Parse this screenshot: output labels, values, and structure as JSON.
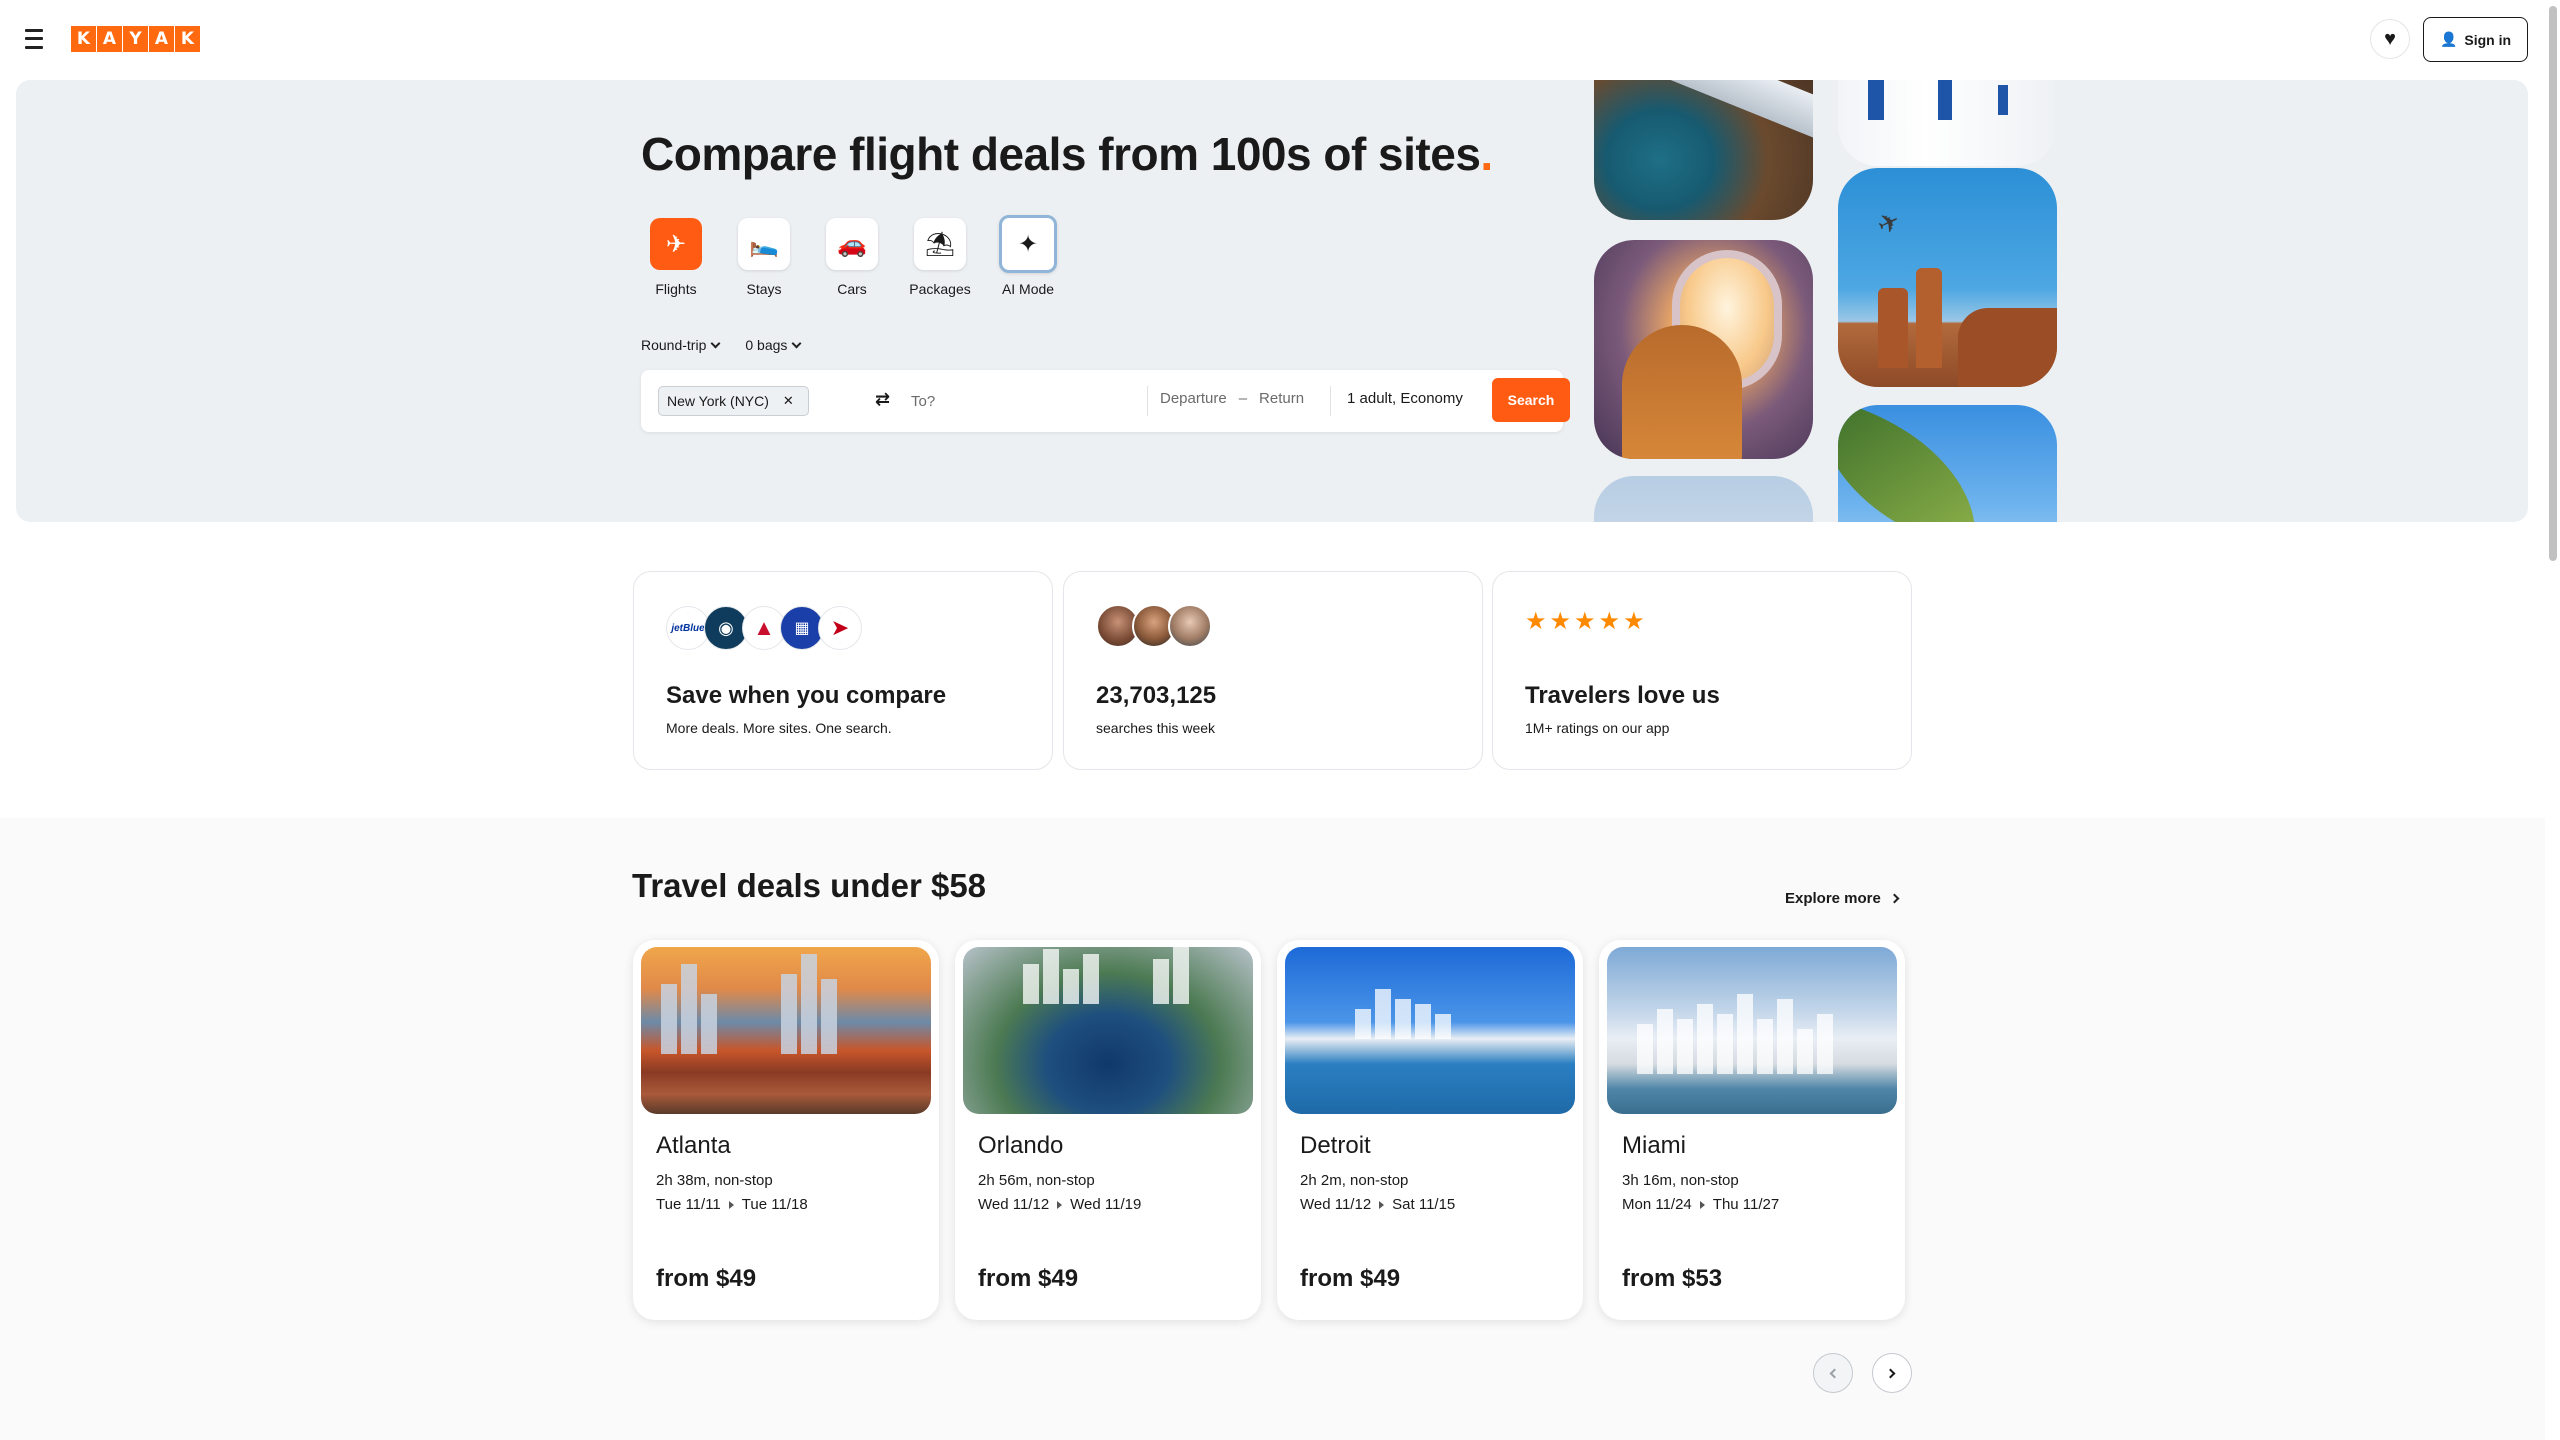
{
  "header": {
    "logo_letters": [
      "K",
      "A",
      "Y",
      "A",
      "K"
    ],
    "signin_label": "Sign in"
  },
  "hero": {
    "title": "Compare flight deals from 100s of sites",
    "title_dot": ".",
    "verticals": [
      {
        "label": "Flights",
        "icon": "plane-icon"
      },
      {
        "label": "Stays",
        "icon": "bed-icon"
      },
      {
        "label": "Cars",
        "icon": "car-icon"
      },
      {
        "label": "Packages",
        "icon": "umbrella-icon"
      },
      {
        "label": "AI Mode",
        "icon": "sparkle-icon"
      }
    ],
    "trip_type": "Round-trip",
    "bags": "0 bags",
    "origin": "New York (NYC)",
    "destination_placeholder": "To?",
    "departure_placeholder": "Departure",
    "date_separator": "–",
    "return_placeholder": "Return",
    "travelers": "1 adult, Economy",
    "search_label": "Search"
  },
  "stats": [
    {
      "title": "Save when you compare",
      "subtitle": "More deals. More sites. One search."
    },
    {
      "title": "23,703,125",
      "subtitle": "searches this week"
    },
    {
      "title": "Travelers love us",
      "subtitle": "1M+ ratings on our app"
    }
  ],
  "airlines": [
    "jetBlue"
  ],
  "deals": {
    "title": "Travel deals under $58",
    "explore_label": "Explore more",
    "cards": [
      {
        "city": "Atlanta",
        "duration": "2h 38m, non-stop",
        "depart": "Tue 11/11",
        "return": "Tue 11/18",
        "price": "from $49"
      },
      {
        "city": "Orlando",
        "duration": "2h 56m, non-stop",
        "depart": "Wed 11/12",
        "return": "Wed 11/19",
        "price": "from $49"
      },
      {
        "city": "Detroit",
        "duration": "2h 2m, non-stop",
        "depart": "Wed 11/12",
        "return": "Sat 11/15",
        "price": "from $49"
      },
      {
        "city": "Miami",
        "duration": "3h 16m, non-stop",
        "depart": "Mon 11/24",
        "return": "Thu 11/27",
        "price": "from $53"
      }
    ]
  },
  "colors": {
    "brand_orange": "#ff690f",
    "search_orange": "#ff5b12",
    "star_orange": "#ff8a00",
    "hero_bg": "#edf0f3"
  }
}
